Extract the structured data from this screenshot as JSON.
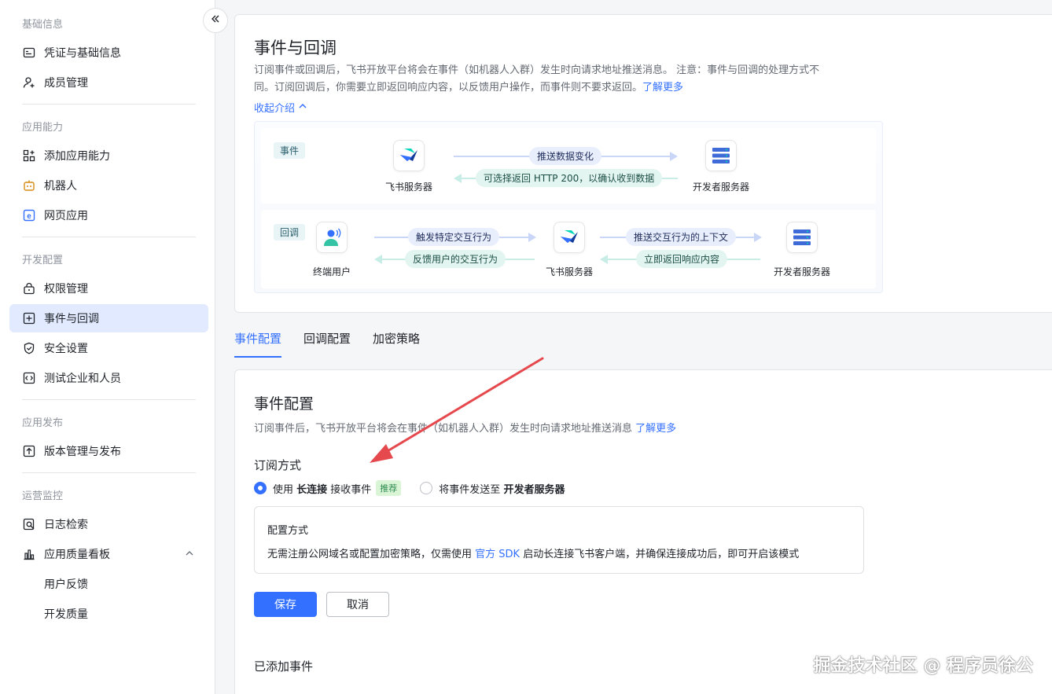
{
  "sidebar": {
    "groups": [
      {
        "title": "基础信息",
        "items": [
          {
            "label": "凭证与基础信息",
            "icon": "id-card-icon"
          },
          {
            "label": "成员管理",
            "icon": "add-user-icon"
          }
        ]
      },
      {
        "title": "应用能力",
        "items": [
          {
            "label": "添加应用能力",
            "icon": "apps-add-icon"
          },
          {
            "label": "机器人",
            "icon": "robot-icon"
          },
          {
            "label": "网页应用",
            "icon": "web-app-icon"
          }
        ]
      },
      {
        "title": "开发配置",
        "items": [
          {
            "label": "权限管理",
            "icon": "lock-icon"
          },
          {
            "label": "事件与回调",
            "icon": "event-icon"
          },
          {
            "label": "安全设置",
            "icon": "shield-icon"
          },
          {
            "label": "测试企业和人员",
            "icon": "code-icon"
          }
        ]
      },
      {
        "title": "应用发布",
        "items": [
          {
            "label": "版本管理与发布",
            "icon": "upload-icon"
          }
        ]
      },
      {
        "title": "运营监控",
        "items": [
          {
            "label": "日志检索",
            "icon": "log-search-icon"
          },
          {
            "label": "应用质量看板",
            "icon": "bar-chart-icon"
          },
          {
            "label": "用户反馈"
          },
          {
            "label": "开发质量"
          }
        ]
      }
    ],
    "active": "事件与回调"
  },
  "intro": {
    "title": "事件与回调",
    "desc_line1": "订阅事件或回调后，飞书开放平台将会在事件（如机器人入群）发生时向请求地址推送消息。 注意：事件与回调的处理方式不",
    "desc_line2": "同。订阅回调后，你需要立即返回响应内容，以反馈用户操作，而事件则不要求返回。",
    "learn_more": "了解更多",
    "collapse": "收起介绍"
  },
  "diagram": {
    "event": {
      "tag": "事件",
      "left_node": "飞书服务器",
      "right_node": "开发者服务器",
      "forward": "推送数据变化",
      "backward": "可选择返回 HTTP 200，以确认收到数据"
    },
    "callback": {
      "tag": "回调",
      "node1": "终端用户",
      "node2": "飞书服务器",
      "node3": "开发者服务器",
      "forward1": "触发特定交互行为",
      "backward1": "反馈用户的交互行为",
      "forward2": "推送交互行为的上下文",
      "backward2": "立即返回响应内容"
    }
  },
  "tabs": [
    "事件配置",
    "回调配置",
    "加密策略"
  ],
  "active_tab": "事件配置",
  "config": {
    "title": "事件配置",
    "desc": "订阅事件后，飞书开放平台将会在事件（如机器人入群）发生时向请求地址推送消息",
    "learn_more": "了解更多",
    "subscribe_title": "订阅方式",
    "option1_pre": "使用 ",
    "option1_bold": "长连接",
    "option1_post": " 接收事件",
    "option1_badge": "推荐",
    "option2_pre": "将事件发送至 ",
    "option2_bold": "开发者服务器",
    "mode_title": "配置方式",
    "mode_desc_pre": "无需注册公网域名或配置加密策略，仅需使用 ",
    "mode_desc_link": "官方 SDK",
    "mode_desc_post": " 启动长连接飞书客户端，并确保连接成功后，即可开启该模式",
    "save": "保存",
    "cancel": "取消",
    "added_title": "已添加事件"
  },
  "watermark": "掘金技术社区 @ 程序员徐公",
  "colors": {
    "primary": "#3370ff",
    "active_nav_bg": "#e1eaff",
    "annotation_arrow": "#e5484d"
  }
}
